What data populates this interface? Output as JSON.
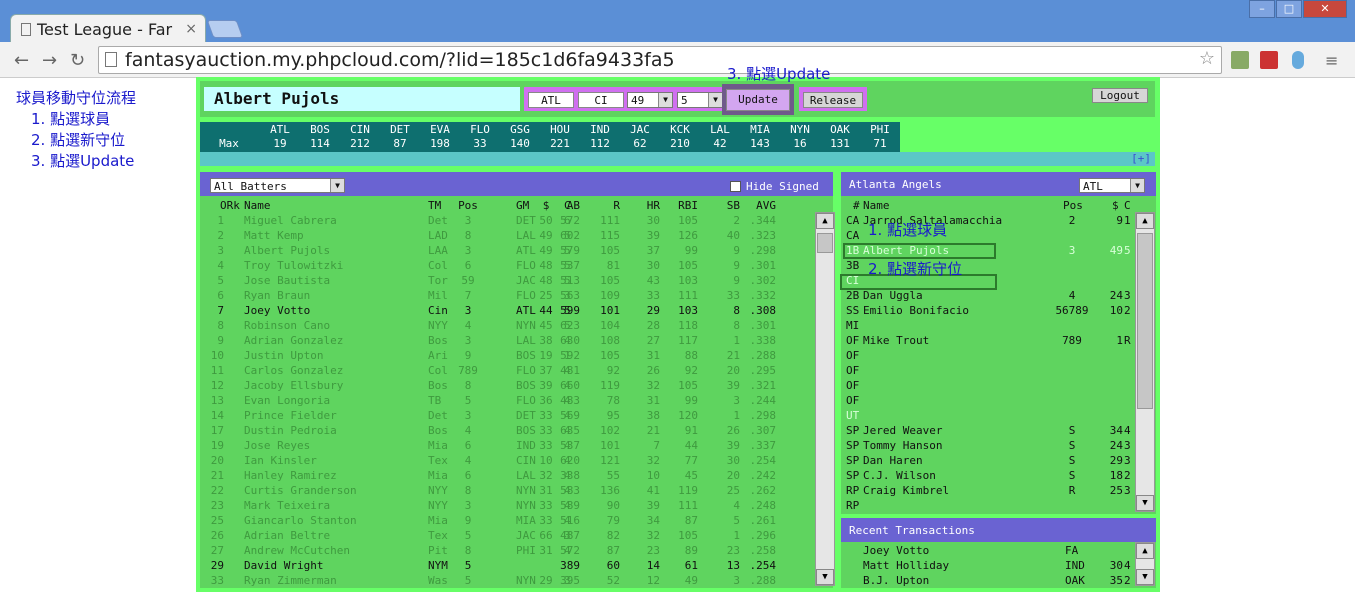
{
  "browser": {
    "tab_title": "Test League - Far",
    "url": "fantasyauction.my.phpcloud.com/?lid=185c1d6fa9433fa5"
  },
  "sidebar": {
    "title": "球員移動守位流程",
    "steps": [
      "1. 點選球員",
      "2. 點選新守位",
      "3. 點選Update"
    ]
  },
  "annotations": {
    "step3": "3. 點選Update",
    "step1": "1. 點選球員",
    "step2": "2. 點選新守位"
  },
  "controls": {
    "player_name": "Albert Pujols",
    "team_field": "ATL",
    "pos_field": "CI",
    "salary_select": "49",
    "contract_select": "5",
    "update_button": "Update",
    "release_button": "Release",
    "logout_button": "Logout"
  },
  "max_table": {
    "row_label": "Max",
    "teams": [
      "ATL",
      "BOS",
      "CIN",
      "DET",
      "EVA",
      "FLO",
      "GSG",
      "HOU",
      "IND",
      "JAC",
      "KCK",
      "LAL",
      "MIA",
      "NYN",
      "OAK",
      "PHI"
    ],
    "values": [
      "19",
      "114",
      "212",
      "87",
      "198",
      "33",
      "140",
      "221",
      "112",
      "62",
      "210",
      "42",
      "143",
      "16",
      "131",
      "71"
    ],
    "expand_link": "[+]"
  },
  "batters": {
    "filter_select": "All Batters",
    "hide_signed_label": "Hide Signed",
    "header": {
      "ork": "ORk",
      "name": "Name",
      "tm": "TM",
      "pos": "Pos",
      "gm": "GM",
      "dollar": "$",
      "c": "C",
      "ab": "AB",
      "r": "R",
      "hr": "HR",
      "rbi": "RBI",
      "sb": "SB",
      "avg": "AVG"
    },
    "rows": [
      {
        "ork": "1",
        "name": "Miguel Cabrera",
        "tm": "Det",
        "pos": "3",
        "gm": "DET",
        "dollar": "50",
        "c": "6",
        "ab": "572",
        "r": "111",
        "hr": "30",
        "rbi": "105",
        "sb": "2",
        "avg": ".344",
        "hl": false
      },
      {
        "ork": "2",
        "name": "Matt Kemp",
        "tm": "LAD",
        "pos": "8",
        "gm": "LAL",
        "dollar": "49",
        "c": "5",
        "ab": "602",
        "r": "115",
        "hr": "39",
        "rbi": "126",
        "sb": "40",
        "avg": ".323",
        "hl": false
      },
      {
        "ork": "3",
        "name": "Albert Pujols",
        "tm": "LAA",
        "pos": "3",
        "gm": "ATL",
        "dollar": "49",
        "c": "5",
        "ab": "579",
        "r": "105",
        "hr": "37",
        "rbi": "99",
        "sb": "9",
        "avg": ".298",
        "hl": false
      },
      {
        "ork": "4",
        "name": "Troy Tulowitzki",
        "tm": "Col",
        "pos": "6",
        "gm": "FLO",
        "dollar": "48",
        "c": "5",
        "ab": "537",
        "r": "81",
        "hr": "30",
        "rbi": "105",
        "sb": "9",
        "avg": ".301",
        "hl": false
      },
      {
        "ork": "5",
        "name": "Jose Bautista",
        "tm": "Tor",
        "pos": "59",
        "gm": "JAC",
        "dollar": "48",
        "c": "5",
        "ab": "513",
        "r": "105",
        "hr": "43",
        "rbi": "103",
        "sb": "9",
        "avg": ".302",
        "hl": false
      },
      {
        "ork": "6",
        "name": "Ryan Braun",
        "tm": "Mil",
        "pos": "7",
        "gm": "FLO",
        "dollar": "25",
        "c": "3",
        "ab": "563",
        "r": "109",
        "hr": "33",
        "rbi": "111",
        "sb": "33",
        "avg": ".332",
        "hl": false
      },
      {
        "ork": "7",
        "name": "Joey Votto",
        "tm": "Cin",
        "pos": "3",
        "gm": "ATL",
        "dollar": "44",
        "c": "5",
        "ab": "599",
        "r": "101",
        "hr": "29",
        "rbi": "103",
        "sb": "8",
        "avg": ".308",
        "hl": true
      },
      {
        "ork": "8",
        "name": "Robinson Cano",
        "tm": "NYY",
        "pos": "4",
        "gm": "NYN",
        "dollar": "45",
        "c": "5",
        "ab": "623",
        "r": "104",
        "hr": "28",
        "rbi": "118",
        "sb": "8",
        "avg": ".301",
        "hl": false
      },
      {
        "ork": "9",
        "name": "Adrian Gonzalez",
        "tm": "Bos",
        "pos": "3",
        "gm": "LAL",
        "dollar": "38",
        "c": "4",
        "ab": "630",
        "r": "108",
        "hr": "27",
        "rbi": "117",
        "sb": "1",
        "avg": ".338",
        "hl": false
      },
      {
        "ork": "10",
        "name": "Justin Upton",
        "tm": "Ari",
        "pos": "9",
        "gm": "BOS",
        "dollar": "19",
        "c": "1",
        "ab": "592",
        "r": "105",
        "hr": "31",
        "rbi": "88",
        "sb": "21",
        "avg": ".288",
        "hl": false
      },
      {
        "ork": "11",
        "name": "Carlos Gonzalez",
        "tm": "Col",
        "pos": "789",
        "gm": "FLO",
        "dollar": "37",
        "c": "4",
        "ab": "481",
        "r": "92",
        "hr": "26",
        "rbi": "92",
        "sb": "20",
        "avg": ".295",
        "hl": false
      },
      {
        "ork": "12",
        "name": "Jacoby Ellsbury",
        "tm": "Bos",
        "pos": "8",
        "gm": "BOS",
        "dollar": "39",
        "c": "4",
        "ab": "660",
        "r": "119",
        "hr": "32",
        "rbi": "105",
        "sb": "39",
        "avg": ".321",
        "hl": false
      },
      {
        "ork": "13",
        "name": "Evan Longoria",
        "tm": "TB",
        "pos": "5",
        "gm": "FLO",
        "dollar": "36",
        "c": "4",
        "ab": "483",
        "r": "78",
        "hr": "31",
        "rbi": "99",
        "sb": "3",
        "avg": ".244",
        "hl": false
      },
      {
        "ork": "14",
        "name": "Prince Fielder",
        "tm": "Det",
        "pos": "3",
        "gm": "DET",
        "dollar": "33",
        "c": "4",
        "ab": "569",
        "r": "95",
        "hr": "38",
        "rbi": "120",
        "sb": "1",
        "avg": ".298",
        "hl": false
      },
      {
        "ork": "17",
        "name": "Dustin Pedroia",
        "tm": "Bos",
        "pos": "4",
        "gm": "BOS",
        "dollar": "33",
        "c": "4",
        "ab": "635",
        "r": "102",
        "hr": "21",
        "rbi": "91",
        "sb": "26",
        "avg": ".307",
        "hl": false
      },
      {
        "ork": "19",
        "name": "Jose Reyes",
        "tm": "Mia",
        "pos": "6",
        "gm": "IND",
        "dollar": "33",
        "c": "4",
        "ab": "537",
        "r": "101",
        "hr": "7",
        "rbi": "44",
        "sb": "39",
        "avg": ".337",
        "hl": false
      },
      {
        "ork": "20",
        "name": "Ian Kinsler",
        "tm": "Tex",
        "pos": "4",
        "gm": "CIN",
        "dollar": "10",
        "c": "4",
        "ab": "620",
        "r": "121",
        "hr": "32",
        "rbi": "77",
        "sb": "30",
        "avg": ".254",
        "hl": false
      },
      {
        "ork": "21",
        "name": "Hanley Ramirez",
        "tm": "Mia",
        "pos": "6",
        "gm": "LAL",
        "dollar": "32",
        "c": "4",
        "ab": "338",
        "r": "55",
        "hr": "10",
        "rbi": "45",
        "sb": "20",
        "avg": ".242",
        "hl": false
      },
      {
        "ork": "22",
        "name": "Curtis Granderson",
        "tm": "NYY",
        "pos": "8",
        "gm": "NYN",
        "dollar": "31",
        "c": "4",
        "ab": "583",
        "r": "136",
        "hr": "41",
        "rbi": "119",
        "sb": "25",
        "avg": ".262",
        "hl": false
      },
      {
        "ork": "23",
        "name": "Mark Teixeira",
        "tm": "NYY",
        "pos": "3",
        "gm": "NYN",
        "dollar": "33",
        "c": "4",
        "ab": "589",
        "r": "90",
        "hr": "39",
        "rbi": "111",
        "sb": "4",
        "avg": ".248",
        "hl": false
      },
      {
        "ork": "25",
        "name": "Giancarlo Stanton",
        "tm": "Mia",
        "pos": "9",
        "gm": "MIA",
        "dollar": "33",
        "c": "4",
        "ab": "516",
        "r": "79",
        "hr": "34",
        "rbi": "87",
        "sb": "5",
        "avg": ".261",
        "hl": false
      },
      {
        "ork": "26",
        "name": "Adrian Beltre",
        "tm": "Tex",
        "pos": "5",
        "gm": "JAC",
        "dollar": "66",
        "c": "3",
        "ab": "487",
        "r": "82",
        "hr": "32",
        "rbi": "105",
        "sb": "1",
        "avg": ".296",
        "hl": false
      },
      {
        "ork": "27",
        "name": "Andrew McCutchen",
        "tm": "Pit",
        "pos": "8",
        "gm": "PHI",
        "dollar": "31",
        "c": "4",
        "ab": "572",
        "r": "87",
        "hr": "23",
        "rbi": "89",
        "sb": "23",
        "avg": ".258",
        "hl": false
      },
      {
        "ork": "29",
        "name": "David Wright",
        "tm": "NYM",
        "pos": "5",
        "gm": "",
        "dollar": "",
        "c": "",
        "ab": "389",
        "r": "60",
        "hr": "14",
        "rbi": "61",
        "sb": "13",
        "avg": ".254",
        "hl": true
      },
      {
        "ork": "33",
        "name": "Ryan Zimmerman",
        "tm": "Was",
        "pos": "5",
        "gm": "NYN",
        "dollar": "29",
        "c": "3",
        "ab": "395",
        "r": "52",
        "hr": "12",
        "rbi": "49",
        "sb": "3",
        "avg": ".288",
        "hl": false
      }
    ]
  },
  "roster": {
    "team_name": "Atlanta Angels",
    "team_select": "ATL",
    "header": {
      "num": "#",
      "name": "Name",
      "pos": "Pos",
      "dollar": "$",
      "c": "C"
    },
    "rows": [
      {
        "slot": "CA",
        "name": "Jarrod Saltalamacchia",
        "pos": "2",
        "dollar": "9",
        "c": "1",
        "empty": false
      },
      {
        "slot": "CA",
        "name": "",
        "pos": "",
        "dollar": "",
        "c": "",
        "empty": false
      },
      {
        "slot": "1B",
        "name": "Albert Pujols",
        "pos": "3",
        "dollar": "49",
        "c": "5",
        "empty": true
      },
      {
        "slot": "3B",
        "name": "",
        "pos": "",
        "dollar": "",
        "c": "",
        "empty": false
      },
      {
        "slot": "CI",
        "name": "",
        "pos": "",
        "dollar": "",
        "c": "",
        "empty": true
      },
      {
        "slot": "2B",
        "name": "Dan Uggla",
        "pos": "4",
        "dollar": "24",
        "c": "3",
        "empty": false
      },
      {
        "slot": "SS",
        "name": "Emilio Bonifacio",
        "pos": "56789",
        "dollar": "10",
        "c": "2",
        "empty": false
      },
      {
        "slot": "MI",
        "name": "",
        "pos": "",
        "dollar": "",
        "c": "",
        "empty": false
      },
      {
        "slot": "OF",
        "name": "Mike Trout",
        "pos": "789",
        "dollar": "1",
        "c": "R",
        "empty": false
      },
      {
        "slot": "OF",
        "name": "",
        "pos": "",
        "dollar": "",
        "c": "",
        "empty": false
      },
      {
        "slot": "OF",
        "name": "",
        "pos": "",
        "dollar": "",
        "c": "",
        "empty": false
      },
      {
        "slot": "OF",
        "name": "",
        "pos": "",
        "dollar": "",
        "c": "",
        "empty": false
      },
      {
        "slot": "OF",
        "name": "",
        "pos": "",
        "dollar": "",
        "c": "",
        "empty": false
      },
      {
        "slot": "UT",
        "name": "",
        "pos": "",
        "dollar": "",
        "c": "",
        "empty": true
      },
      {
        "slot": "SP",
        "name": "Jered Weaver",
        "pos": "S",
        "dollar": "34",
        "c": "4",
        "empty": false
      },
      {
        "slot": "SP",
        "name": "Tommy Hanson",
        "pos": "S",
        "dollar": "24",
        "c": "3",
        "empty": false
      },
      {
        "slot": "SP",
        "name": "Dan Haren",
        "pos": "S",
        "dollar": "29",
        "c": "3",
        "empty": false
      },
      {
        "slot": "SP",
        "name": "C.J. Wilson",
        "pos": "S",
        "dollar": "18",
        "c": "2",
        "empty": false
      },
      {
        "slot": "RP",
        "name": "Craig Kimbrel",
        "pos": "R",
        "dollar": "25",
        "c": "3",
        "empty": false
      },
      {
        "slot": "RP",
        "name": "",
        "pos": "",
        "dollar": "",
        "c": "",
        "empty": false
      }
    ]
  },
  "transactions": {
    "title": "Recent Transactions",
    "rows": [
      {
        "name": "Joey Votto",
        "team": "FA",
        "dollar": "",
        "c": ""
      },
      {
        "name": "Matt Holliday",
        "team": "IND",
        "dollar": "30",
        "c": "4"
      },
      {
        "name": "B.J. Upton",
        "team": "OAK",
        "dollar": "35",
        "c": "2"
      }
    ]
  },
  "colors": {
    "frame_green": "#67ff67",
    "panel_green": "#5fd45f",
    "header_purple": "#6a63d2",
    "name_cyan": "#c6ffff",
    "max_teal": "#0e6f6f",
    "annotation_blue": "#1a1acc"
  }
}
